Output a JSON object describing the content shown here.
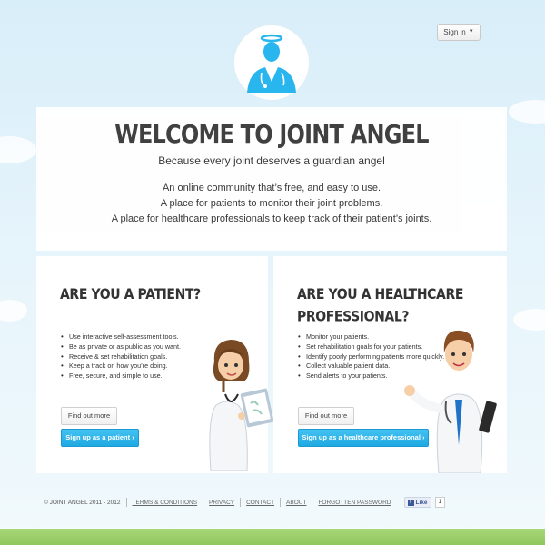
{
  "header": {
    "signin_label": "Sign in",
    "logo_icon": "angel-doctor-logo-icon"
  },
  "hero": {
    "title": "WELCOME TO JOINT ANGEL",
    "subtitle": "Because every joint deserves a guardian angel",
    "lines": [
      "An online community that’s free, and easy to use.",
      "A place for patients to monitor their joint problems.",
      "A place for healthcare professionals to keep track of their patient’s joints."
    ]
  },
  "patient_card": {
    "title_line1": "ARE YOU A PATIENT?",
    "bullets": [
      "Use interactive self-assessment tools.",
      "Be as private or as public as you want.",
      "Receive & set rehabilitation goals.",
      "Keep a track on how you’re doing.",
      "Free, secure, and simple to use."
    ],
    "find_out_label": "Find out more",
    "signup_label": "Sign up as a patient ›"
  },
  "pro_card": {
    "title_line1": "ARE YOU A HEALTHCARE",
    "title_line2": "PROFESSIONAL?",
    "bullets": [
      "Monitor your patients.",
      "Set rehabilitation goals for your patients.",
      "Identify poorly performing patients more quickly.",
      "Collect valuable patient data.",
      "Send alerts to your patients."
    ],
    "find_out_label": "Find out more",
    "signup_label": "Sign up as a healthcare professional ›"
  },
  "footer": {
    "copyright": "© JOINT ANGEL 2011 - 2012",
    "links": [
      "TERMS & CONDITIONS",
      "PRIVACY",
      "CONTACT",
      "ABOUT",
      "FORGOTTEN PASSWORD"
    ],
    "like_label": "Like",
    "like_count": "1"
  },
  "colors": {
    "accent_blue": "#1fa9e2",
    "logo_blue": "#29b6ee",
    "grass": "#9bcf69"
  }
}
